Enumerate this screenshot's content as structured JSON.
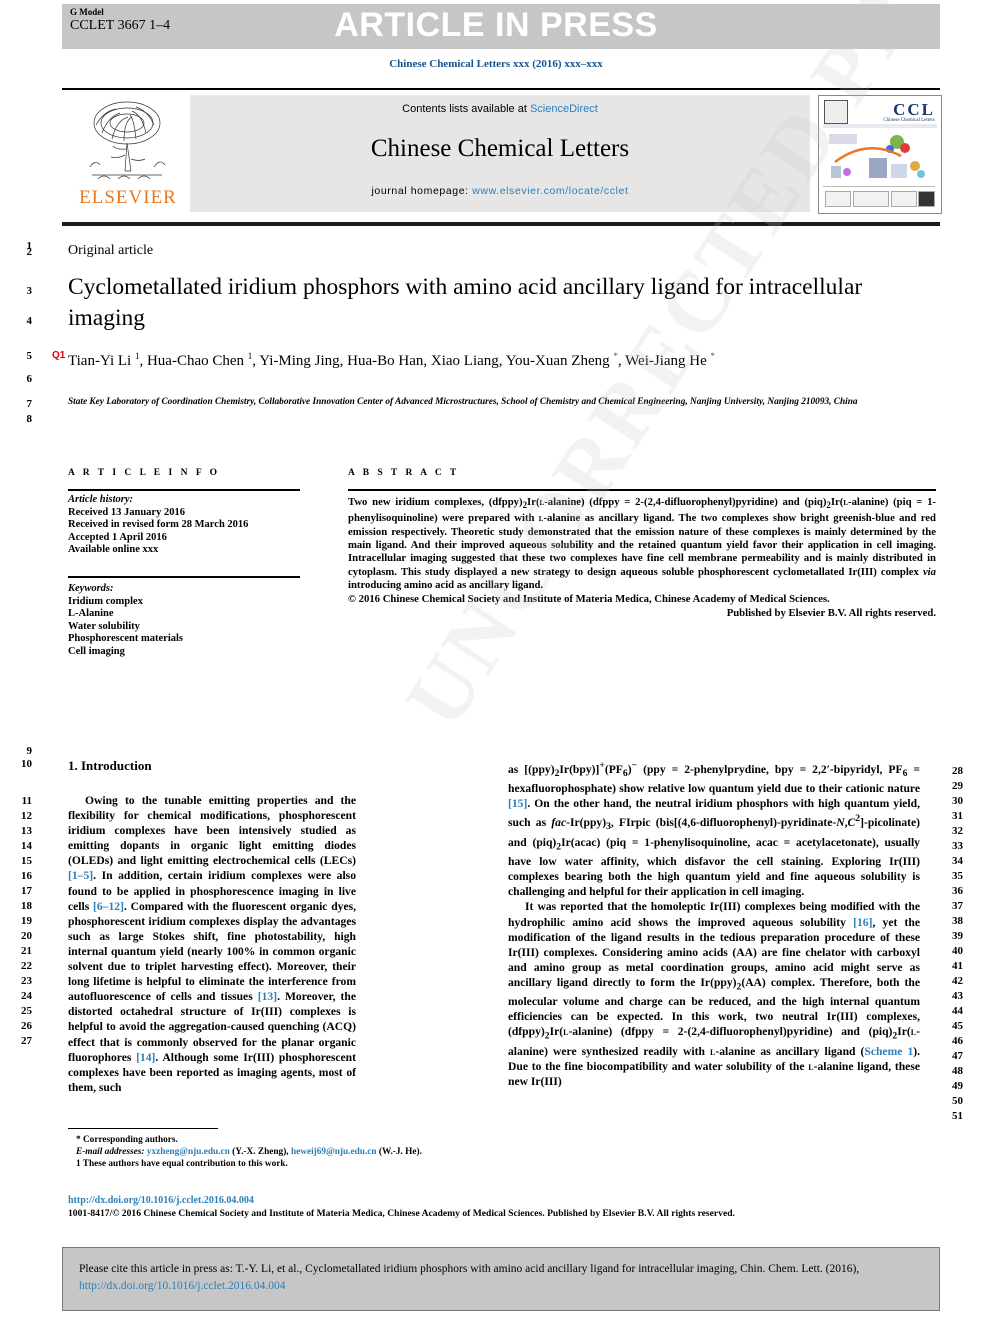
{
  "header": {
    "g_model_label": "G Model",
    "manuscript_id": "CCLET 3667 1–4",
    "article_in_press": "ARTICLE IN PRESS",
    "journal_ref": "Chinese Chemical Letters xxx (2016) xxx–xxx"
  },
  "masthead": {
    "contents_prefix": "Contents lists available at ",
    "sciencedirect": "ScienceDirect",
    "journal_title": "Chinese Chemical Letters",
    "homepage_label": "journal homepage: ",
    "homepage_url": "www.elsevier.com/locate/cclet",
    "publisher": "ELSEVIER",
    "cover_acronym": "CCL",
    "cover_sub": "Chinese Chemical Letters"
  },
  "article": {
    "type": "Original article",
    "title": "Cyclometallated iridium phosphors with amino acid ancillary ligand for intracellular imaging",
    "query_flag": "Q1",
    "authors_html": "Tian-Yi Li <sup>1</sup>, Hua-Chao Chen <sup>1</sup>, Yi-Ming Jing, Hua-Bo Han, Xiao Liang, You-Xuan Zheng <sup class=\"star\">*</sup>, Wei-Jiang He <sup class=\"star\">*</sup>",
    "affiliation": "State Key Laboratory of Coordination Chemistry, Collaborative Innovation Center of Advanced Microstructures, School of Chemistry and Chemical Engineering, Nanjing University, Nanjing 210093, China"
  },
  "article_info": {
    "heading": "A R T I C L E   I N F O",
    "history_label": "Article history:",
    "history": [
      "Received 13 January 2016",
      "Received in revised form 28 March 2016",
      "Accepted 1 April 2016",
      "Available online xxx"
    ],
    "keywords_label": "Keywords:",
    "keywords": [
      "Iridium complex",
      "L-Alanine",
      "Water solubility",
      "Phosphorescent materials",
      "Cell imaging"
    ]
  },
  "abstract": {
    "heading": "A B S T R A C T",
    "body_html": "Two new iridium complexes, (dfppy)<sub>2</sub>Ir(<span class=\"smallcap\">l</span>-alanine) (dfppy = 2-(2,4-difluorophenyl)pyridine) and (piq)<sub>2</sub>Ir(<span class=\"smallcap\">l</span>-alanine) (piq = 1-phenylisoquinoline) were prepared with <span class=\"smallcap\">l</span>-alanine as ancillary ligand. The two complexes show bright greenish-blue and red emission respectively. Theoretic study demonstrated that the emission nature of these complexes is mainly determined by the main ligand. And their improved aqueous solubility and the retained quantum yield favor their application in cell imaging. Intracellular imaging suggested that these two complexes have fine cell membrane permeability and is mainly distributed in cytoplasm. This study displayed a new strategy to design aqueous soluble phosphorescent cyclometallated Ir(III) complex <span class=\"ital\">via</span> introducing amino acid as ancillary ligand.",
    "copyright": "© 2016 Chinese Chemical Society and Institute of Materia Medica, Chinese Academy of Medical Sciences.",
    "published_by": "Published by Elsevier B.V. All rights reserved."
  },
  "body": {
    "section_heading": "1. Introduction",
    "left_column_html": "<p>Owing to the tunable emitting properties and the flexibility for chemical modifications, phosphorescent iridium complexes have been intensively studied as emitting dopants in organic light emitting diodes (OLEDs) and light emitting electrochemical cells (LECs) <span class=\"ref\">[1–5]</span>. In addition, certain iridium complexes were also found to be applied in phosphorescence imaging in live cells <span class=\"ref\">[6–12]</span>. Compared with the fluorescent organic dyes, phosphorescent iridium complexes display the advantages such as large Stokes shift, fine photostability, high internal quantum yield (nearly 100% in common organic solvent due to triplet harvesting effect). Moreover, their long lifetime is helpful to eliminate the interference from autofluorescence of cells and tissues <span class=\"ref\">[13]</span>. Moreover, the distorted octahedral structure of Ir(III) complexes is helpful to avoid the aggregation-caused quenching (ACQ) effect that is commonly observed for the planar organic fluorophores <span class=\"ref\">[14]</span>. Although some Ir(III) phosphorescent complexes have been reported as imaging agents, most of them, such</p>",
    "right_column_html": "<p style=\"text-indent:0\">as [(ppy)<sub>2</sub>Ir(bpy)]<sup>+</sup>(PF<sub>6</sub>)<sup>−</sup> (ppy = 2-phenylprydine, bpy = 2,2′-bipyridyl, PF<sub>6</sub> = hexafluorophosphate) show relative low quantum yield due to their cationic nature <span class=\"ref\">[15]</span>. On the other hand, the neutral iridium phosphors with high quantum yield, such as <span class=\"ital\">fac</span>-Ir(ppy)<sub>3</sub>, FIrpic (bis[(4,6-difluorophenyl)-pyridinate-<span class=\"ital\">N</span>,<span class=\"ital\">C</span><sup>2</sup>]-picolinate) and (piq)<sub>2</sub>Ir(acac) (piq = 1-phenylisoquinoline, acac = acetylacetonate), usually have low water affinity, which disfavor the cell staining. Exploring Ir(III) complexes bearing both the high quantum yield and fine aqueous solubility is challenging and helpful for their application in cell imaging.</p><p>It was reported that the homoleptic Ir(III) complexes being modified with the hydrophilic amino acid shows the improved aqueous solubility <span class=\"ref\">[16]</span>, yet the modification of the ligand results in the tedious preparation procedure of these Ir(III) complexes. Considering amino acids (AA) are fine chelator with carboxyl and amino group as metal coordination groups, amino acid might serve as ancillary ligand directly to form the Ir(ppy)<sub>2</sub>(AA) complex. Therefore, both the molecular volume and charge can be reduced, and the high internal quantum efficiencies can be expected. In this work, two neutral Ir(III) complexes, (dfppy)<sub>2</sub>Ir(<span class=\"smallcap\">l</span>-alanine) (dfppy = 2-(2,4-difluorophenyl)pyridine) and (piq)<sub>2</sub>Ir(<span class=\"smallcap\">l</span>-alanine) were synthesized readily with <span class=\"smallcap\">l</span>-alanine as ancillary ligand (<span class=\"ref\">Scheme 1</span>). Due to the fine biocompatibility and water solubility of the <span class=\"smallcap\">l</span>-alanine ligand, these new Ir(III)</p>"
  },
  "line_numbers": {
    "head": [
      "1",
      "2",
      "3",
      "4",
      "5",
      "6",
      "7",
      "8"
    ],
    "left": [
      "9",
      "10",
      "11",
      "12",
      "13",
      "14",
      "15",
      "16",
      "17",
      "18",
      "19",
      "20",
      "21",
      "22",
      "23",
      "24",
      "25",
      "26",
      "27"
    ],
    "right": [
      "28",
      "29",
      "30",
      "31",
      "32",
      "33",
      "34",
      "35",
      "36",
      "37",
      "38",
      "39",
      "40",
      "41",
      "42",
      "43",
      "44",
      "45",
      "46",
      "47",
      "48",
      "49",
      "50",
      "51"
    ]
  },
  "footnotes": {
    "corresponding": "* Corresponding authors.",
    "email_label": "E-mail addresses:",
    "email1": "yxzheng@nju.edu.cn",
    "email1_who": "(Y.-X. Zheng),",
    "email2": "heweij69@nju.edu.cn",
    "email2_who": "(W.-J. He).",
    "equal_contrib": "1 These authors have equal contribution to this work.",
    "doi": "http://dx.doi.org/10.1016/j.cclet.2016.04.004",
    "copyright_line": "1001-8417/© 2016 Chinese Chemical Society and Institute of Materia Medica, Chinese Academy of Medical Sciences. Published by Elsevier B.V. All rights reserved."
  },
  "cite_box": {
    "text_before": "Please cite this article in press as: T.-Y. Li, et al., Cyclometallated iridium phosphors with amino acid ancillary ligand for intracellular imaging, Chin. Chem. Lett. (2016), ",
    "link": "http://dx.doi.org/10.1016/j.cclet.2016.04.004"
  },
  "watermark": {
    "text": "UNCORRECTED PROOF"
  },
  "colors": {
    "link": "#2c7fb8",
    "journal_ref": "#14558f",
    "query_flag": "#e00000",
    "elsevier_orange": "#e87722",
    "band_grey": "#c6c6c6"
  }
}
